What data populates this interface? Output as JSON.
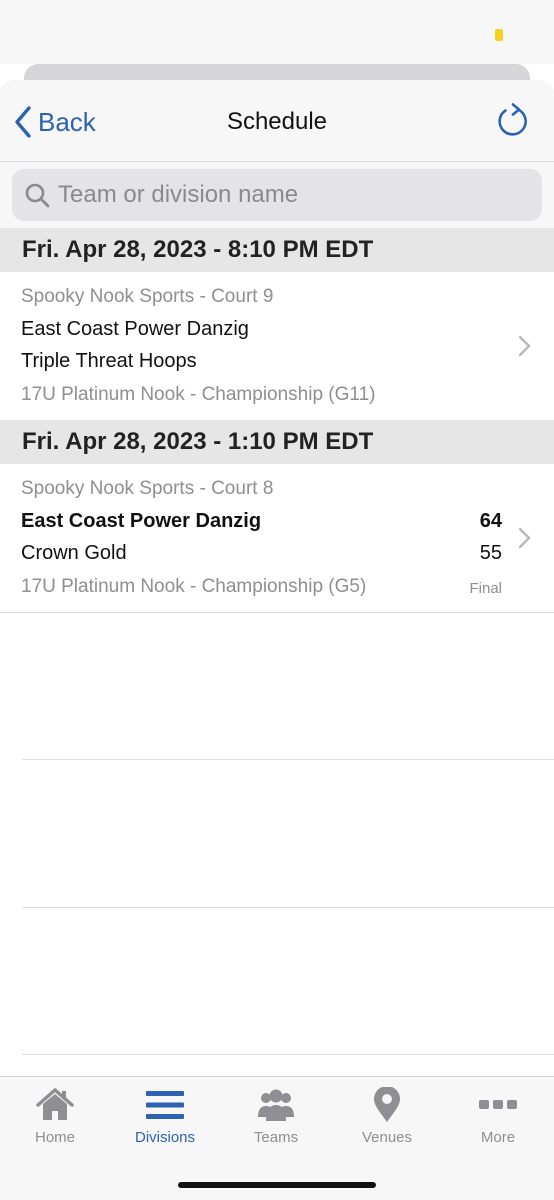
{
  "nav": {
    "back_label": "Back",
    "title": "Schedule"
  },
  "search": {
    "placeholder": "Team or division name",
    "value": ""
  },
  "sections": [
    {
      "header": "Fri. Apr 28, 2023 - 8:10 PM EDT",
      "game": {
        "venue": "Spooky Nook Sports - Court 9",
        "team1": "East Coast Power Danzig",
        "team2": "Triple Threat Hoops",
        "division": "17U Platinum Nook - Championship (G11)"
      }
    },
    {
      "header": "Fri. Apr 28, 2023 - 1:10 PM EDT",
      "game": {
        "venue": "Spooky Nook Sports - Court 8",
        "team1": "East Coast Power Danzig",
        "team1_score": "64",
        "team2": "Crown Gold",
        "team2_score": "55",
        "division": "17U Platinum Nook - Championship (G5)",
        "status": "Final"
      }
    }
  ],
  "tabs": [
    {
      "label": "Home",
      "icon": "home-icon"
    },
    {
      "label": "Divisions",
      "icon": "list-icon",
      "active": true
    },
    {
      "label": "Teams",
      "icon": "team-icon"
    },
    {
      "label": "Venues",
      "icon": "map-pin-icon"
    },
    {
      "label": "More",
      "icon": "more-icon"
    }
  ],
  "colors": {
    "accent": "#2b62b2",
    "inactive": "#8e8e93",
    "section_bg": "#e6e6e6"
  }
}
